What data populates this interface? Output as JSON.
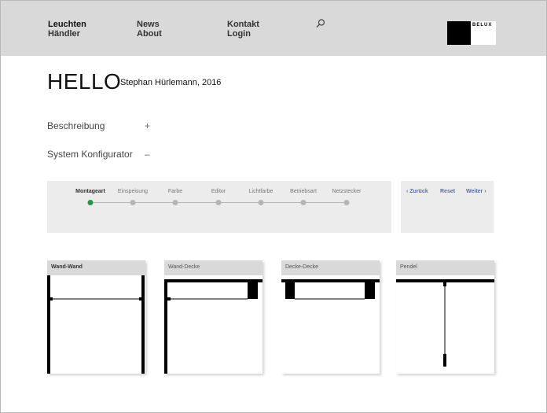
{
  "nav": {
    "col1": [
      "Leuchten",
      "Händler"
    ],
    "col2": [
      "News",
      "About"
    ],
    "col3": [
      "Kontakt",
      "Login"
    ]
  },
  "search": {
    "icon": "search-icon"
  },
  "logo": {
    "text": "BELUX"
  },
  "page": {
    "title": "HELLO",
    "subtitle": "Stephan Hürlemann, 2016"
  },
  "accordion": [
    {
      "label": "Beschreibung",
      "sign": "+"
    },
    {
      "label": "System Konfigurator",
      "sign": "–"
    }
  ],
  "stepper": {
    "steps": [
      "Montageart",
      "Einspeisung",
      "Farbe",
      "Editor",
      "Lichtfarbe",
      "Betriebsart",
      "Netzstecker"
    ],
    "active_index": 0,
    "active_color": "#1f9a4a"
  },
  "controls": {
    "back": "‹ Zurück",
    "reset": "Reset",
    "next": "Weiter ›"
  },
  "cards": [
    {
      "label": "Wand-Wand"
    },
    {
      "label": "Wand-Decke"
    },
    {
      "label": "Decke-Decke"
    },
    {
      "label": "Pendel"
    }
  ]
}
